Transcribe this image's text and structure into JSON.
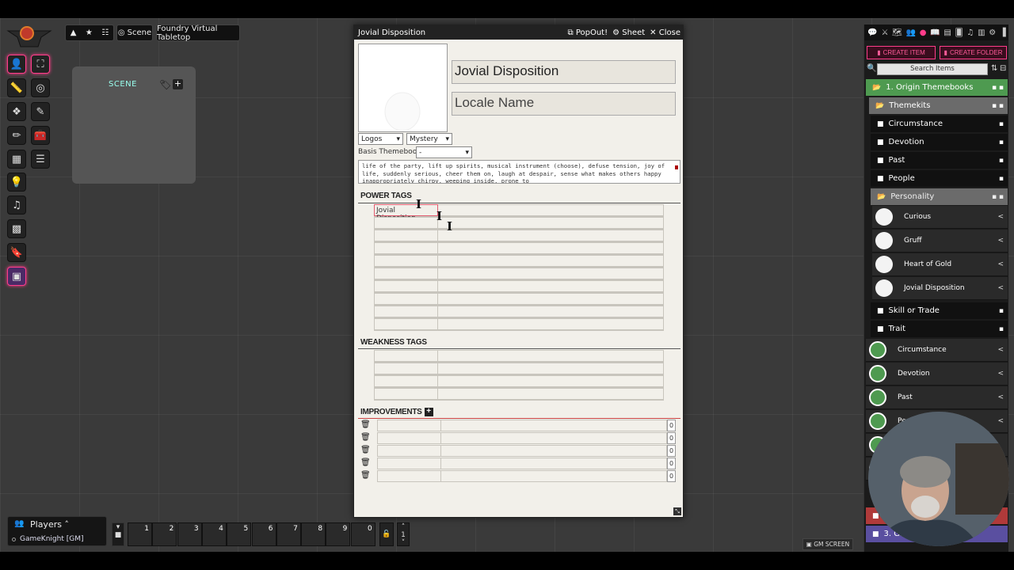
{
  "topbar": {
    "scene_nav_label": "Scene",
    "world_title": "Foundry Virtual Tabletop"
  },
  "scene_panel": {
    "title": "SCENE"
  },
  "sheet": {
    "window_title": "Jovial Disposition",
    "popout_label": "PopOut!",
    "sheet_label": "Sheet",
    "close_label": "Close",
    "name_value": "Jovial Disposition",
    "locale_placeholder": "Locale Name",
    "type_select": "Logos",
    "subtype_select": "Mystery",
    "basis_label": "Basis Themebook",
    "basis_select": "-",
    "description": "life of the party, lift up spirits, musical instrument (choose), defuse tension, joy of life, suddenly serious, cheer them on, laugh at despair, sense what makes others happy inappropriately chirpy, weeping inside, prone to",
    "power_tags_heading": "POWER TAGS",
    "power_tags": [
      "Jovial Disposition",
      "",
      "",
      "",
      "",
      "",
      "",
      "",
      "",
      ""
    ],
    "weakness_tags_heading": "WEAKNESS TAGS",
    "weakness_tags": [
      "",
      "",
      "",
      ""
    ],
    "improvements_heading": "IMPROVEMENTS",
    "improvements": [
      {
        "name": "",
        "desc": "",
        "uses": "0"
      },
      {
        "name": "",
        "desc": "",
        "uses": "0"
      },
      {
        "name": "",
        "desc": "",
        "uses": "0"
      },
      {
        "name": "",
        "desc": "",
        "uses": "0"
      },
      {
        "name": "",
        "desc": "",
        "uses": "0"
      }
    ]
  },
  "sidebar": {
    "create_item": "CREATE ITEM",
    "create_folder": "CREATE FOLDER",
    "search_placeholder": "Search Items",
    "folders": {
      "origin": "1. Origin Themebooks",
      "themekits": "Themekits",
      "circumstance": "Circumstance",
      "devotion": "Devotion",
      "past": "Past",
      "people": "People",
      "personality": "Personality",
      "skill": "Skill or Trade",
      "trait": "Trait",
      "f2": "2.",
      "f3": "3. Grea"
    },
    "personality_items": [
      "Curious",
      "Gruff",
      "Heart of Gold",
      "Jovial Disposition"
    ],
    "leaf_items": [
      "Circumstance",
      "Devotion",
      "Past",
      "Peo"
    ],
    "colors": {
      "accent": "#ff3c8a",
      "origin_folder": "#4e9a50",
      "personality_folder": "#6b6b6b"
    }
  },
  "players": {
    "title": "Players",
    "user": "GameKnight [GM]"
  },
  "hotbar": {
    "slots": [
      "1",
      "2",
      "3",
      "4",
      "5",
      "6",
      "7",
      "8",
      "9",
      "0"
    ],
    "page": "1"
  },
  "gm_screen_label": "GM SCREEN"
}
